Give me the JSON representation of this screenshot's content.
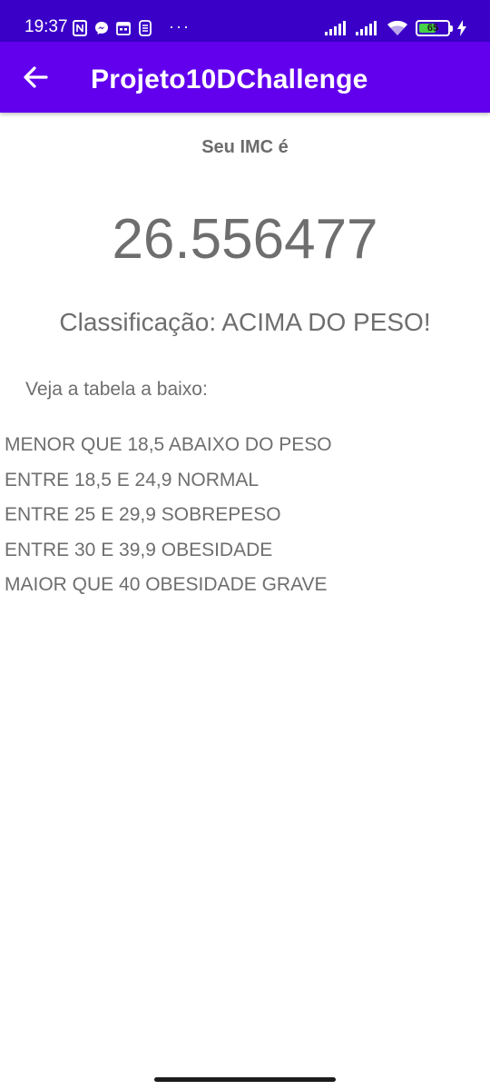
{
  "status_bar": {
    "time": "19:37",
    "dots": "···",
    "battery_level": "65",
    "battery_fraction": 0.65,
    "icons_left": [
      "nfc-icon",
      "messenger-icon",
      "calendar-icon",
      "sim-icon"
    ],
    "icons_right": [
      "signal-icon",
      "signal-icon",
      "wifi-icon",
      "battery-icon",
      "charging-icon"
    ]
  },
  "app_bar": {
    "title": "Projeto10DChallenge",
    "background": "#6200ee",
    "back_icon": "arrow-back-icon"
  },
  "result": {
    "label": "Seu IMC é",
    "value": "26.556477",
    "classification": "Classificação: ACIMA DO PESO!"
  },
  "table": {
    "caption": "Veja a tabela a baixo:",
    "rows": [
      "MENOR QUE 18,5 ABAIXO DO PESO",
      "ENTRE 18,5 E 24,9 NORMAL",
      "ENTRE 25 E 29,9 SOBREPESO",
      "ENTRE 30 E 39,9 OBESIDADE",
      "MAIOR QUE 40 OBESIDADE GRAVE"
    ]
  },
  "colors": {
    "status_bar": "#3a00c7",
    "app_bar": "#6200ee",
    "text": "#6e6e6e",
    "battery": "#46d146"
  }
}
